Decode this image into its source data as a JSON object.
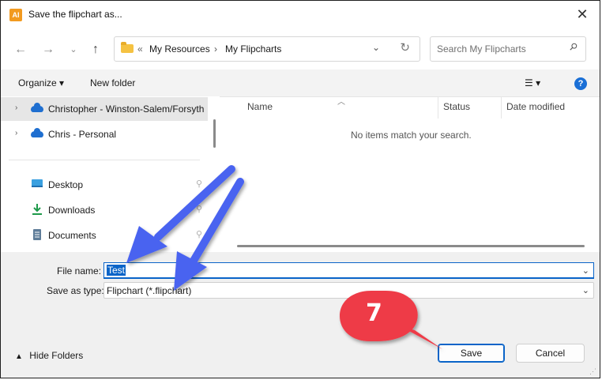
{
  "window": {
    "title": "Save the flipchart as...",
    "app_icon_text": "AI"
  },
  "address": {
    "overflow": "«",
    "crumbs": [
      "My Resources",
      "My Flipcharts"
    ]
  },
  "search": {
    "placeholder": "Search My Flipcharts"
  },
  "toolbar": {
    "organize": "Organize ▾",
    "new_folder": "New folder",
    "view": "☰  ▾",
    "help": "?"
  },
  "nav": {
    "items": [
      {
        "label": "Christopher - Winston-Salem/Forsyth"
      },
      {
        "label": "Chris - Personal"
      }
    ],
    "quick": [
      {
        "label": "Desktop"
      },
      {
        "label": "Downloads"
      },
      {
        "label": "Documents"
      }
    ]
  },
  "filelist": {
    "columns": [
      "Name",
      "Status",
      "Date modified"
    ],
    "empty_message": "No items match your search."
  },
  "save": {
    "filename_label": "File name:",
    "filename_value": "Test",
    "type_label": "Save as type:",
    "type_value": "Flipchart (*.flipchart)",
    "hide_folders": "Hide Folders",
    "save_button": "Save",
    "cancel_button": "Cancel"
  },
  "annotation": {
    "step_number": "7"
  },
  "colors": {
    "accent": "#0a64c8",
    "annotation_arrow": "#4a63f0",
    "badge": "#ee3a47"
  }
}
